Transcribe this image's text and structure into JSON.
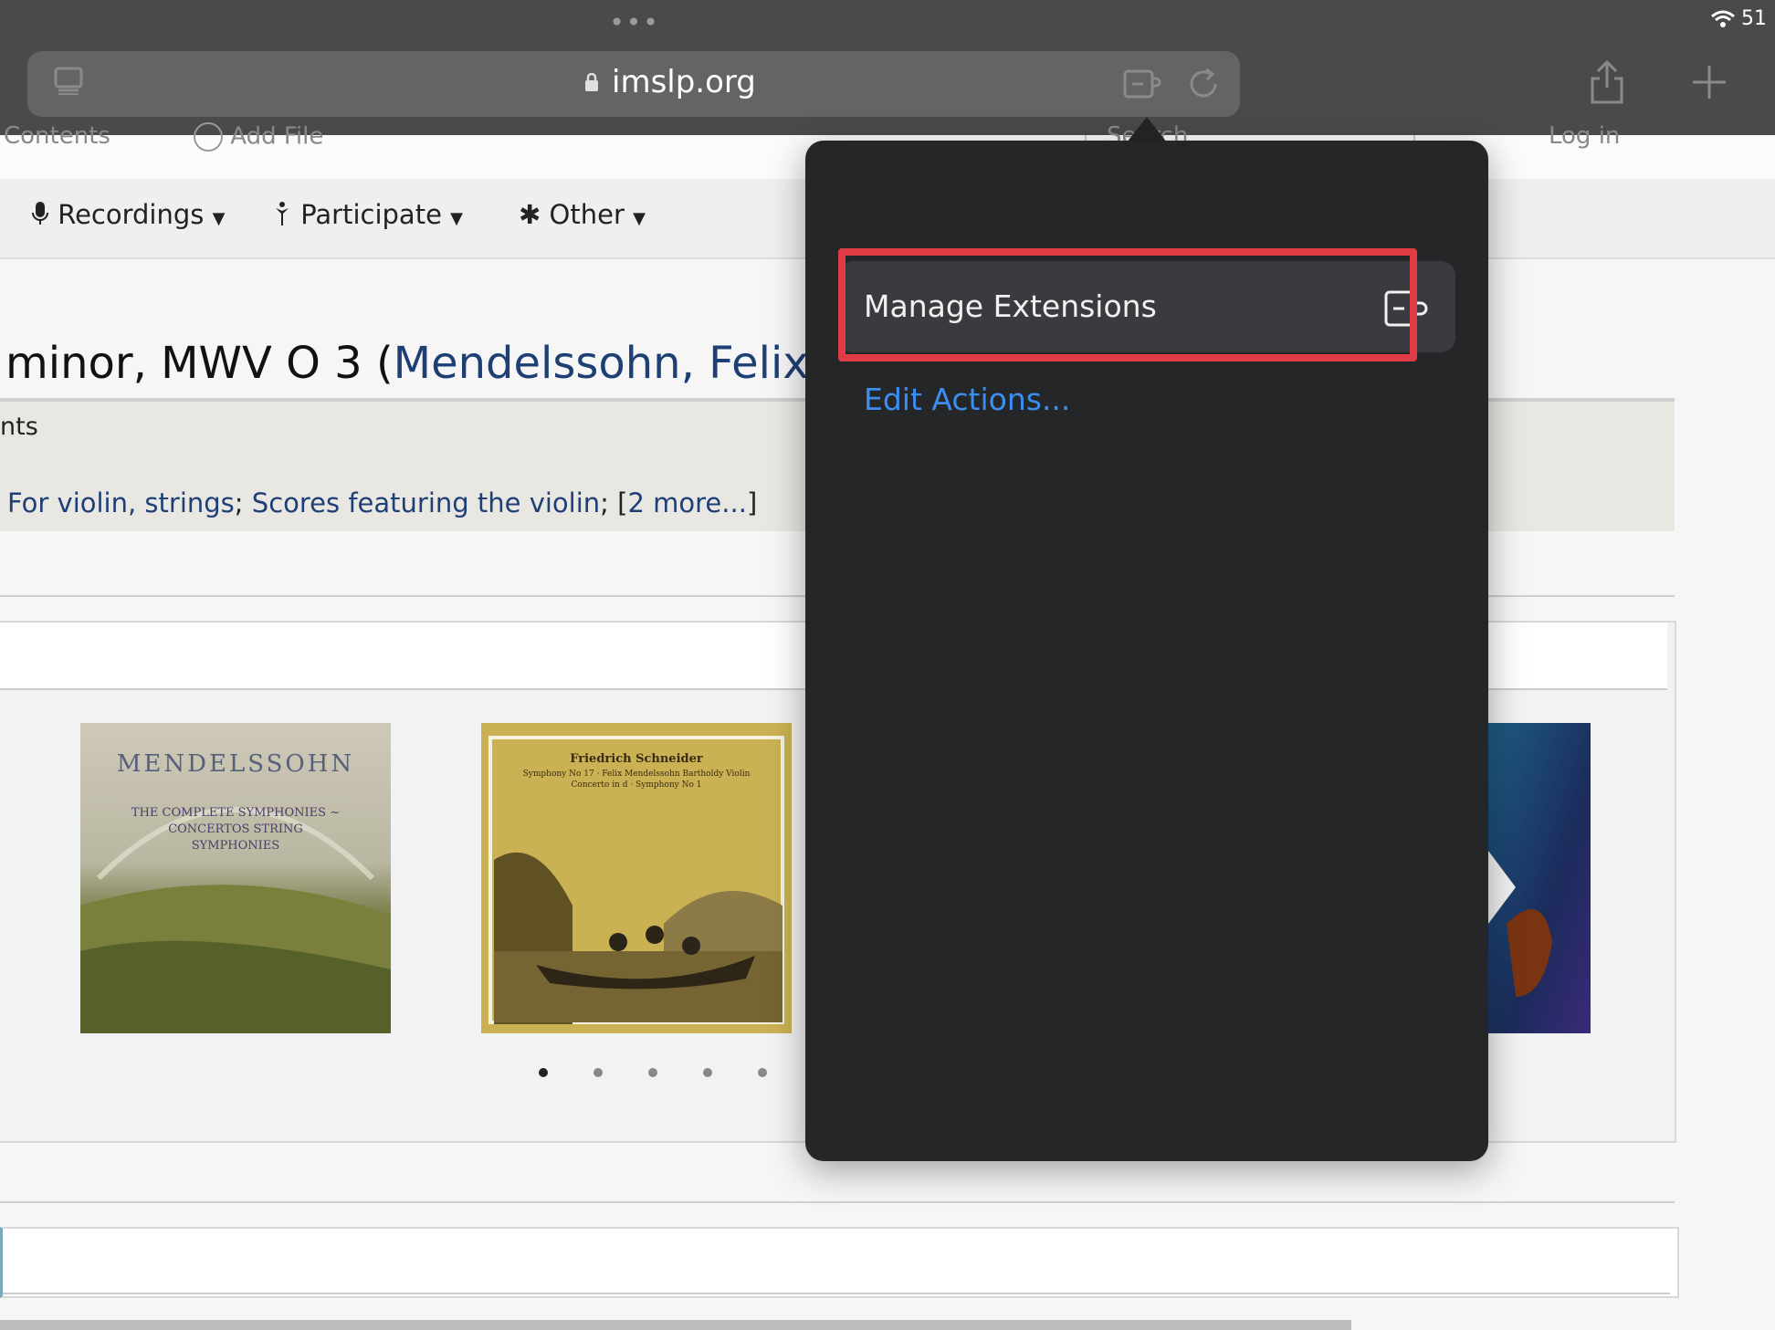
{
  "browser": {
    "status_right": "51",
    "url": "imslp.org",
    "icons": {
      "tabs": "sidebar-icon",
      "extensions": "extension-icon",
      "reload": "reload-icon",
      "share": "share-icon",
      "new_tab": "plus-icon",
      "lock": "lock-icon"
    }
  },
  "site": {
    "nav_top": {
      "left_partial": "Contents",
      "add_file": "Add File",
      "search_partial": "Search",
      "login": "Log in"
    },
    "nav": [
      {
        "label": "Recordings"
      },
      {
        "label": "Participate"
      },
      {
        "label": "Other"
      }
    ],
    "title": {
      "prefix": "minor, MWV O 3 (",
      "link": "Mendelssohn, Felix",
      "suffix": ")"
    },
    "info_partial": "nts",
    "categories": {
      "cat1": "For violin, strings",
      "sep": "; ",
      "cat2": "Scores featuring the violin",
      "open": "; [",
      "more": "2 more...",
      "close": "]"
    },
    "albums": [
      {
        "label": "MENDELSSOHN",
        "sub": "THE COMPLETE SYMPHONIES ~ CONCERTOS STRING SYMPHONIES"
      },
      {
        "label": "Friedrich Schneider",
        "sub": "Symphony No 17 · Felix Mendelssohn Bartholdy Violin Concerto in d · Symphony No 1"
      }
    ]
  },
  "popover": {
    "manage_extensions": "Manage Extensions",
    "edit_actions": "Edit Actions..."
  },
  "colors": {
    "highlight": "#e03c46",
    "link_blue": "#3b8df0"
  }
}
